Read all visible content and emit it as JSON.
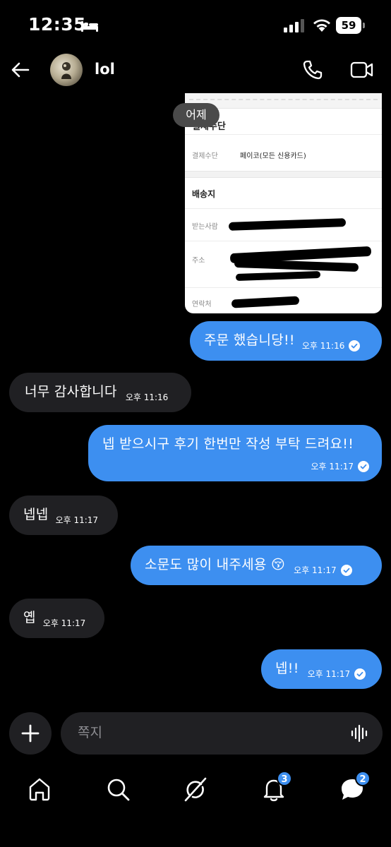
{
  "status": {
    "time": "12:35",
    "battery": "59"
  },
  "header": {
    "name": "lol"
  },
  "date_chip": "어제",
  "order_card": {
    "heading": "결제수단",
    "payment_label": "결제수단",
    "payment_value": "페이코(모든 신용카드)",
    "shipping_heading": "배송지",
    "recipient_label": "받는사람",
    "address_label": "주소",
    "contact_label": "연락처"
  },
  "messages": [
    {
      "direction": "out",
      "text": "주문 했습니당!!",
      "time": "오후 11:16"
    },
    {
      "direction": "in",
      "text": "너무 감사합니다",
      "time": "오후 11:16"
    },
    {
      "direction": "out",
      "text": "넵 받으시구 후기 한번만 작성 부탁 드려요!!",
      "time": "오후 11:17"
    },
    {
      "direction": "in",
      "text": "넵넵",
      "time": "오후 11:17"
    },
    {
      "direction": "out",
      "text": "소문도 많이 내주세용 😚",
      "time": "오후 11:17"
    },
    {
      "direction": "in",
      "text": "옙",
      "time": "오후 11:17"
    },
    {
      "direction": "out",
      "text": "넵!!",
      "time": "오후 11:17"
    }
  ],
  "composer": {
    "placeholder": "쪽지"
  },
  "tabs": {
    "notifications_badge": "3",
    "messages_badge": "2"
  },
  "colors": {
    "accent": "#3d8ff0",
    "incoming_bubble": "#202023",
    "background": "#000000"
  },
  "icons": [
    "back-arrow-icon",
    "phone-icon",
    "video-camera-icon",
    "plus-icon",
    "voice-wave-icon",
    "home-icon",
    "search-icon",
    "grok-slash-icon",
    "bell-icon",
    "chat-bubble-icon",
    "checkmark-icon"
  ]
}
